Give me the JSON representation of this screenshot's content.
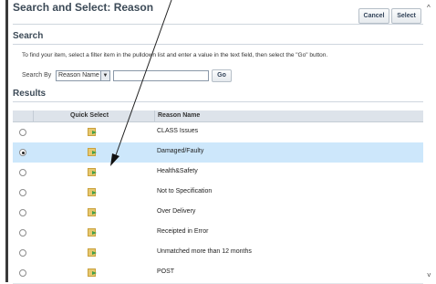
{
  "header": {
    "title": "Search and Select: Reason",
    "cancel_label": "Cancel",
    "select_label": "Select"
  },
  "search": {
    "section_title": "Search",
    "instructions": "To find your item, select a filter item in the pulldown list and enter a value in the text field, then select the \"Go\" button.",
    "search_by_label": "Search By",
    "filter_value": "Reason Name",
    "text_value": "",
    "go_label": "Go"
  },
  "results": {
    "section_title": "Results",
    "columns": [
      "Quick Select",
      "Reason Name"
    ],
    "rows": [
      {
        "name": "CLASS Issues",
        "selected": false
      },
      {
        "name": "Damaged/Faulty",
        "selected": true
      },
      {
        "name": "Health&Safety",
        "selected": false
      },
      {
        "name": "Not to Specification",
        "selected": false
      },
      {
        "name": "Over Delivery",
        "selected": false
      },
      {
        "name": "Receipted in Error",
        "selected": false
      },
      {
        "name": "Unmatched more than 12 months",
        "selected": false
      },
      {
        "name": "POST",
        "selected": false
      }
    ]
  },
  "icons": {
    "quick_select": "quick-select-icon",
    "scroll_up": "chevron-up-icon",
    "scroll_down": "chevron-down-icon",
    "dropdown": "chevron-down-icon"
  },
  "colors": {
    "selected_row": "#cde7fb",
    "header_bg": "#dde3ea",
    "title_text": "#3c4a57"
  }
}
